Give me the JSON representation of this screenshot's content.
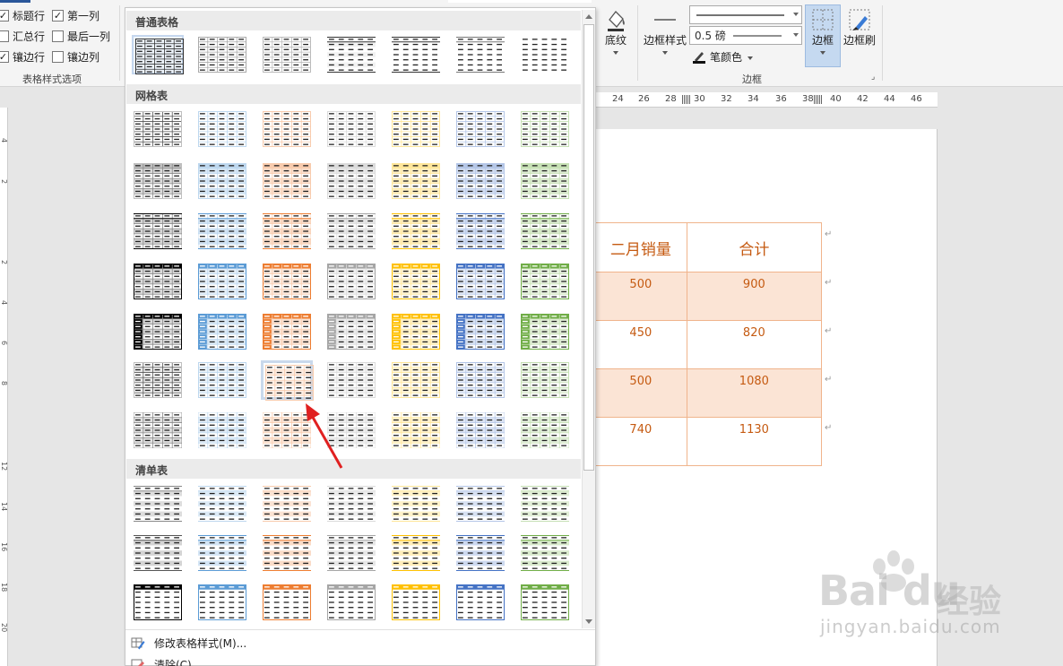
{
  "ribbon": {
    "options": [
      {
        "label": "标题行",
        "checked": true
      },
      {
        "label": "第一列",
        "checked": true
      },
      {
        "label": "汇总行",
        "checked": false
      },
      {
        "label": "最后一列",
        "checked": false
      },
      {
        "label": "镶边行",
        "checked": true
      },
      {
        "label": "镶边列",
        "checked": false
      }
    ],
    "options_group_label": "表格样式选项",
    "shading_label": "底纹",
    "border_styles_label": "边框样式",
    "pen_weight_value": "0.5 磅",
    "pen_color_label": "笔颜色",
    "borders_label": "边框",
    "border_painter_label": "边框刷",
    "borders_group_label": "边框"
  },
  "ruler": {
    "ticks": [
      "24",
      "26",
      "28",
      "30",
      "32",
      "34",
      "36",
      "38",
      "40",
      "42",
      "44",
      "46"
    ],
    "left_ticks": [
      "4",
      "2",
      "2",
      "4",
      "6",
      "8",
      "12",
      "14",
      "16",
      "18",
      "20"
    ]
  },
  "document_table": {
    "headers": [
      "二月销量",
      "合计"
    ],
    "rows": [
      [
        "500",
        "900"
      ],
      [
        "450",
        "820"
      ],
      [
        "500",
        "1080"
      ],
      [
        "740",
        "1130"
      ]
    ]
  },
  "gallery": {
    "sections": [
      "普通表格",
      "网格表",
      "清单表"
    ],
    "menu": {
      "modify_label": "修改表格样式(M)...",
      "clear_label": "清除(C)"
    },
    "colors": [
      "#000000",
      "#5b9bd5",
      "#ed7d31",
      "#a5a5a5",
      "#ffc000",
      "#4472c4",
      "#70ad47"
    ],
    "light_colors": [
      "#bfbfbf",
      "#bdd7ee",
      "#f8cbad",
      "#dbdbdb",
      "#ffe699",
      "#b4c6e7",
      "#c6e0b4"
    ]
  },
  "watermark": {
    "brand": "Bai du",
    "chinese": "经验",
    "url": "jingyan.baidu.com"
  }
}
